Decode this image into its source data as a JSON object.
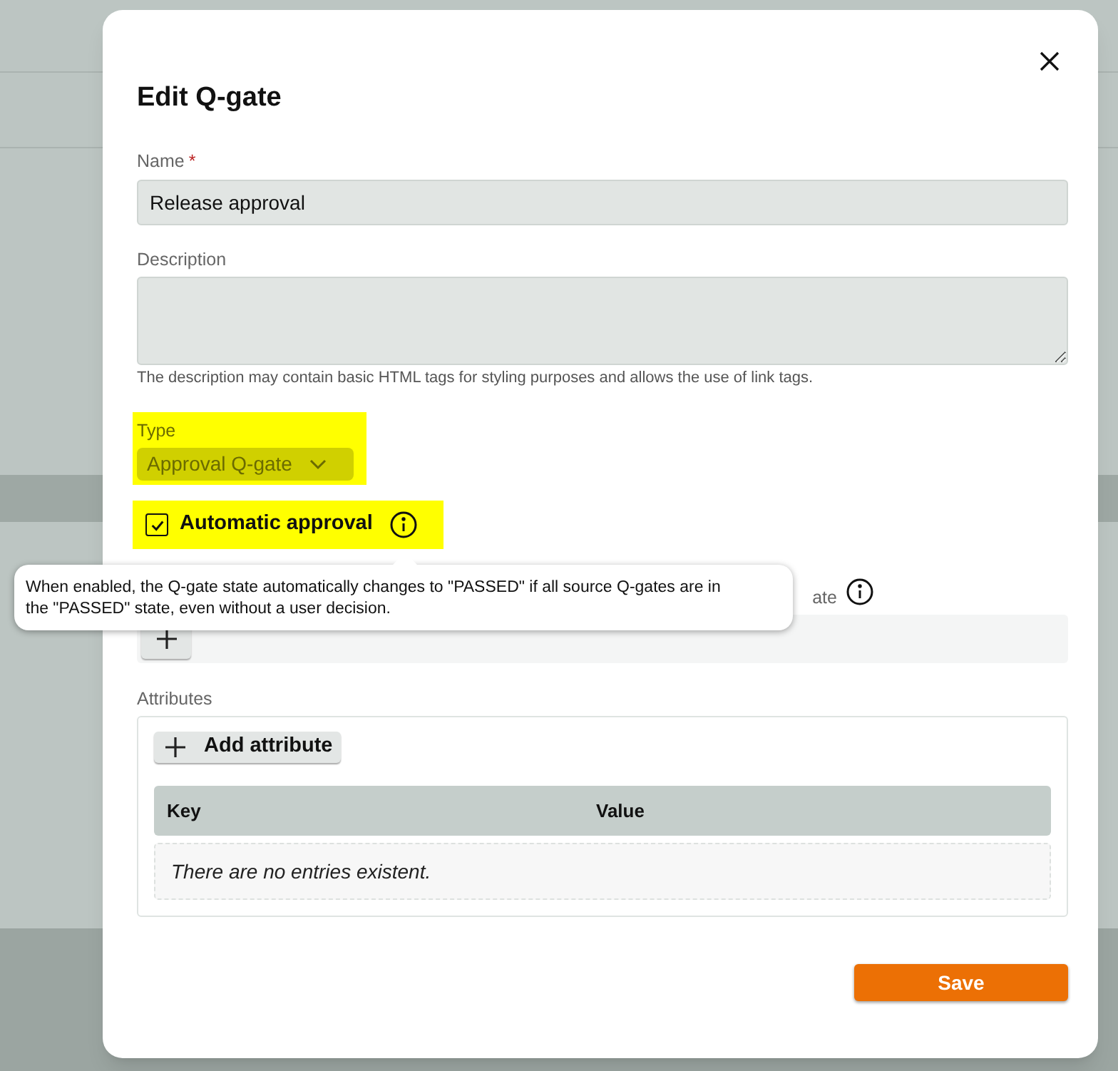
{
  "dialog": {
    "title": "Edit Q-gate"
  },
  "name_field": {
    "label": "Name",
    "required_mark": "*",
    "value": "Release approval"
  },
  "description_field": {
    "label": "Description",
    "help": "The description may contain basic HTML tags for styling purposes and allows the use of link tags."
  },
  "type_field": {
    "label": "Type",
    "value": "Approval Q-gate",
    "highlighted": true
  },
  "automatic_approval": {
    "label": "Automatic approval",
    "checked": true,
    "highlighted": true
  },
  "tooltip": {
    "text": "When enabled, the Q-gate state automatically changes to \"PASSED\" if all source Q-gates are in the \"PASSED\" state, even without a user decision."
  },
  "source_field": {
    "label": "ate"
  },
  "attributes": {
    "label": "Attributes",
    "add_button": "Add attribute",
    "columns": [
      "Key",
      "Value"
    ],
    "empty_text": "There are no entries existent."
  },
  "save_button": "Save"
}
